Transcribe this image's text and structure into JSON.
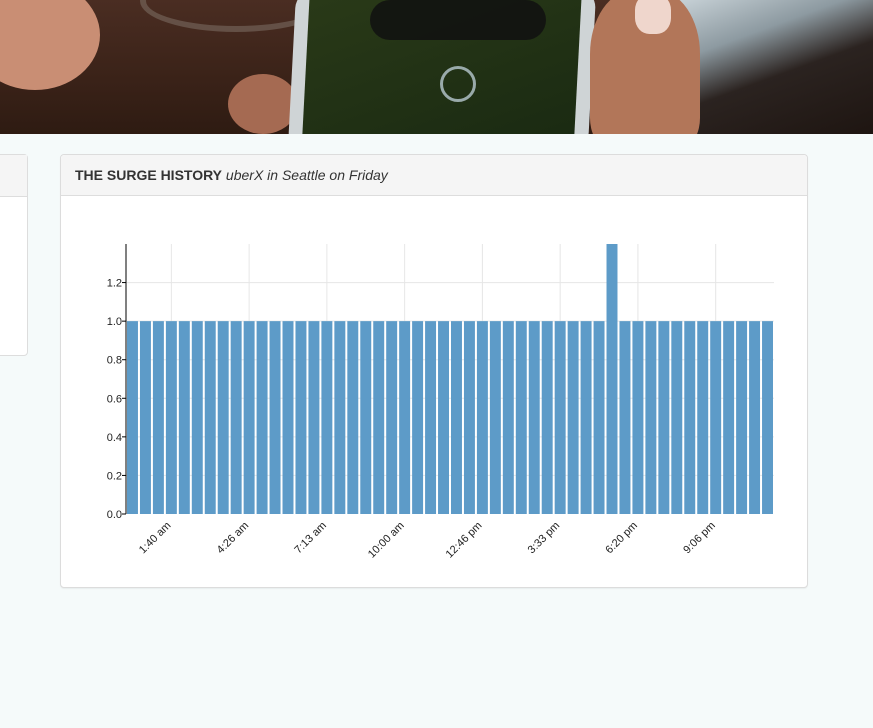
{
  "card": {
    "title_bold": "THE SURGE HISTORY",
    "title_italic": "uberX in Seattle on Friday"
  },
  "colors": {
    "bar": "#5d9bc8",
    "grid": "#e6e6e6",
    "axis": "#000000"
  },
  "chart_data": {
    "type": "bar",
    "title": "",
    "xlabel": "",
    "ylabel": "",
    "ylim": [
      0,
      1.4
    ],
    "yticks": [
      0.0,
      0.2,
      0.4,
      0.6,
      0.8,
      1.0,
      1.2
    ],
    "ytick_labels": [
      "0.0",
      "0.2",
      "0.4",
      "0.6",
      "0.8",
      "1.0",
      "1.2"
    ],
    "x_tick_labels": [
      "1:40 am",
      "4:26 am",
      "7:13 am",
      "10:00 am",
      "12:46 pm",
      "3:33 pm",
      "6:20 pm",
      "9:06 pm"
    ],
    "x_tick_bar_index": [
      3,
      9,
      15,
      21,
      27,
      33,
      39,
      45
    ],
    "grid": true,
    "values": [
      1.0,
      1.0,
      1.0,
      1.0,
      1.0,
      1.0,
      1.0,
      1.0,
      1.0,
      1.0,
      1.0,
      1.0,
      1.0,
      1.0,
      1.0,
      1.0,
      1.0,
      1.0,
      1.0,
      1.0,
      1.0,
      1.0,
      1.0,
      1.0,
      1.0,
      1.0,
      1.0,
      1.0,
      1.0,
      1.0,
      1.0,
      1.0,
      1.0,
      1.0,
      1.0,
      1.0,
      1.0,
      1.4,
      1.0,
      1.0,
      1.0,
      1.0,
      1.0,
      1.0,
      1.0,
      1.0,
      1.0,
      1.0,
      1.0,
      1.0
    ]
  }
}
